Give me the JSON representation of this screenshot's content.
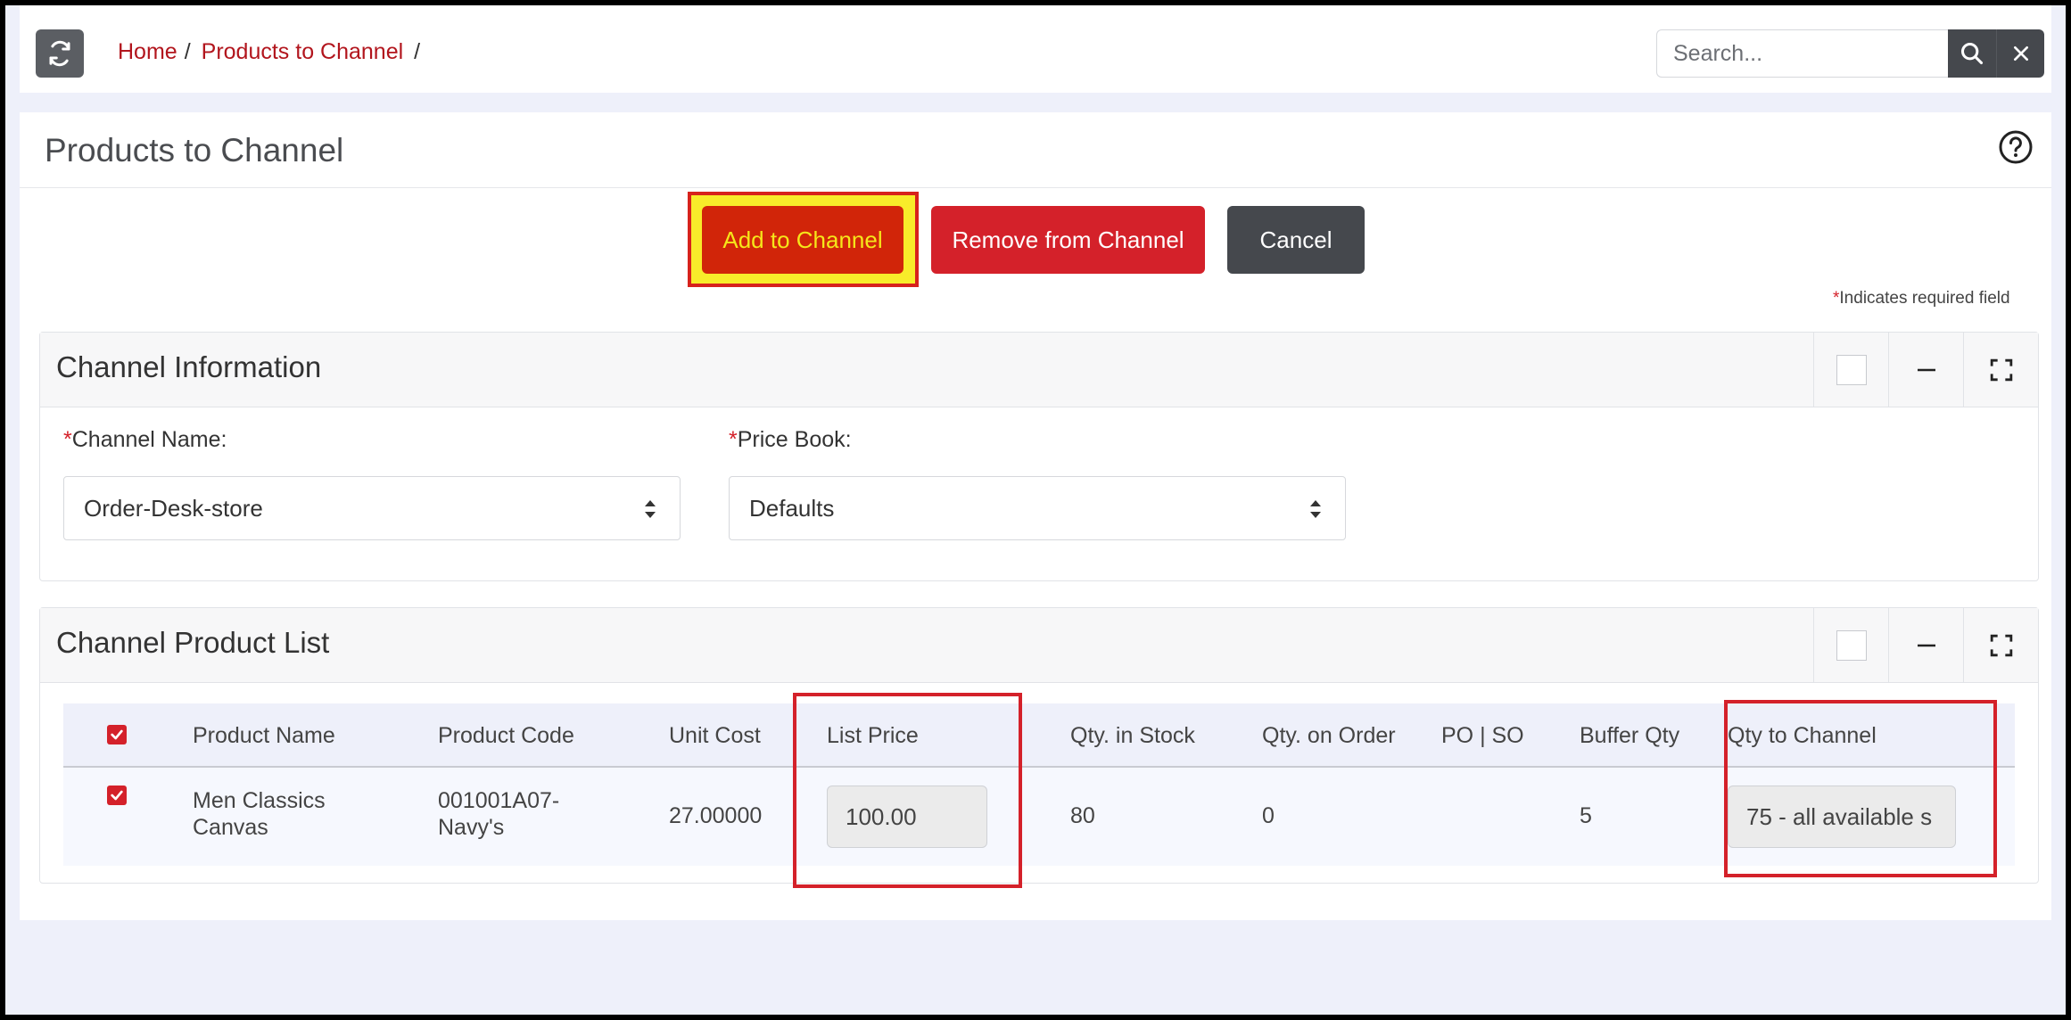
{
  "breadcrumb": {
    "home": "Home",
    "current": "Products to Channel",
    "separator": "/"
  },
  "search": {
    "placeholder": "Search..."
  },
  "page": {
    "title": "Products to Channel"
  },
  "actions": {
    "add": "Add to Channel",
    "remove": "Remove from Channel",
    "cancel": "Cancel"
  },
  "required_note": {
    "star": "*",
    "text": "Indicates required field"
  },
  "channel_info": {
    "title": "Channel Information",
    "channel_name_label": "Channel Name:",
    "channel_name_value": "Order-Desk-store",
    "price_book_label": "Price Book:",
    "price_book_value": "Defaults"
  },
  "product_list": {
    "title": "Channel Product List",
    "columns": [
      "Product Name",
      "Product Code",
      "Unit Cost",
      "List Price",
      "Qty. in Stock",
      "Qty. on Order",
      "PO | SO",
      "Buffer Qty",
      "Qty to Channel"
    ],
    "rows": [
      {
        "checked": true,
        "name_line1": "Men Classics",
        "name_line2": "Canvas",
        "code_line1": "001001A07-",
        "code_line2": "Navy's",
        "unit_cost": "27.00000",
        "list_price": "100.00",
        "qty_in_stock": "80",
        "qty_on_order": "0",
        "po_so": "",
        "buffer_qty": "5",
        "qty_to_channel": "75 - all available s"
      }
    ]
  },
  "colors": {
    "accent_red": "#d4212a",
    "dark_button": "#45484d",
    "highlight_yellow": "#f8ec2a"
  }
}
